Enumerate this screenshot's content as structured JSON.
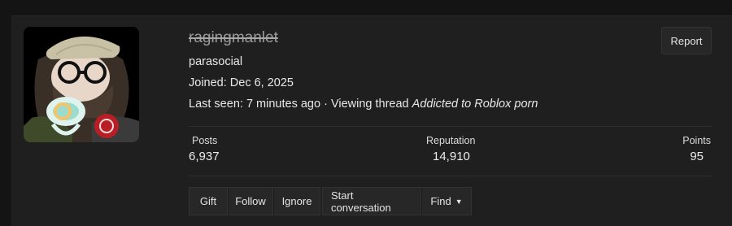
{
  "profile": {
    "username": "ragingmanlet",
    "title": "parasocial",
    "joined_label": "Joined:",
    "joined_value": "Dec 6, 2025",
    "last_seen_label": "Last seen:",
    "last_seen_value": "7 minutes ago",
    "separator": "·",
    "activity_prefix": "Viewing thread",
    "activity_thread": "Addicted to Roblox porn"
  },
  "report_button": "Report",
  "stats": {
    "posts_label": "Posts",
    "posts_value": "6,937",
    "reputation_label": "Reputation",
    "reputation_value": "14,910",
    "points_label": "Points",
    "points_value": "95"
  },
  "actions": {
    "gift": "Gift",
    "follow": "Follow",
    "ignore": "Ignore",
    "start_conversation": "Start conversation",
    "find": "Find"
  },
  "colors": {
    "background": "#141414",
    "card": "#1f1f1f",
    "button": "#272727",
    "text": "#e6e6e6",
    "username_strikethrough": "#9b9b9b"
  }
}
